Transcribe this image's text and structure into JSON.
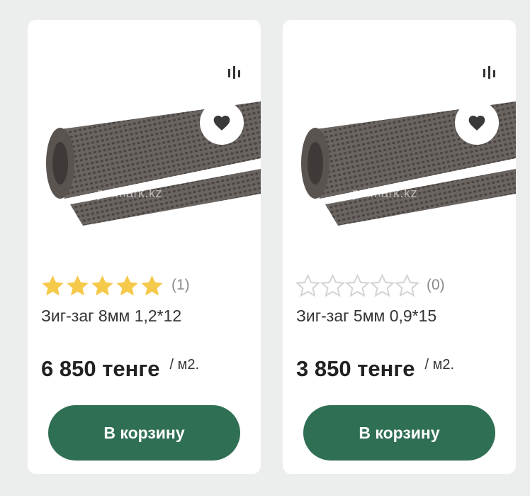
{
  "products": [
    {
      "name": "Зиг-заг 8мм 1,2*12",
      "price": "6 850 тенге",
      "unit": "/ м2.",
      "rating": 5,
      "reviews": "(1)",
      "watermark": "polmark.kz",
      "cart_label": "В корзину",
      "compare_icon": "compare-bars-icon",
      "favorite_icon": "heart-icon"
    },
    {
      "name": "Зиг-заг 5мм 0,9*15",
      "price": "3 850 тенге",
      "unit": "/ м2.",
      "rating": 0,
      "reviews": "(0)",
      "watermark": "polmark.kz",
      "cart_label": "В корзину",
      "compare_icon": "compare-bars-icon",
      "favorite_icon": "heart-icon"
    }
  ],
  "colors": {
    "accent": "#2f6f53",
    "star_filled": "#f5c94a",
    "star_empty": "#d4d4d4",
    "background": "#eceeed",
    "card": "#ffffff"
  }
}
